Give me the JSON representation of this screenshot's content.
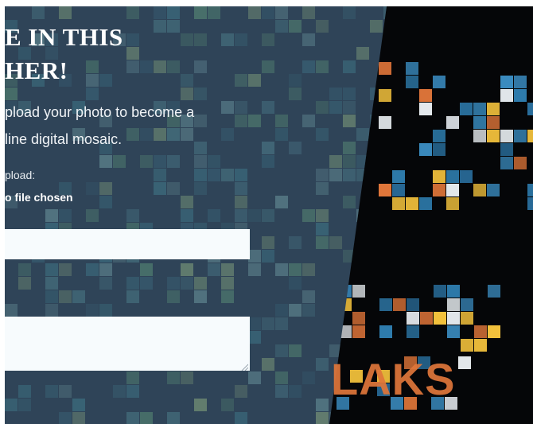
{
  "page": {
    "headline_lines": [
      "E IN THIS",
      "HER!"
    ],
    "description_lines": [
      "pload your photo to become a",
      "line digital mosaic."
    ],
    "upload_label": "pload:",
    "file_status": "o file chosen",
    "text_input": {
      "value": "",
      "placeholder": ""
    },
    "message_field": {
      "value": "",
      "placeholder": ""
    }
  },
  "mosaic": {
    "logo_text": "LAKS",
    "colors": {
      "panel": "#2f4458",
      "dark_background": "#050608",
      "tile_teal": "#3d6f80",
      "tile_blue": "#2f7fb2",
      "tile_yellow": "#f2c13c",
      "tile_orange": "#e0763a",
      "input_background": "#f7fbfd"
    }
  }
}
